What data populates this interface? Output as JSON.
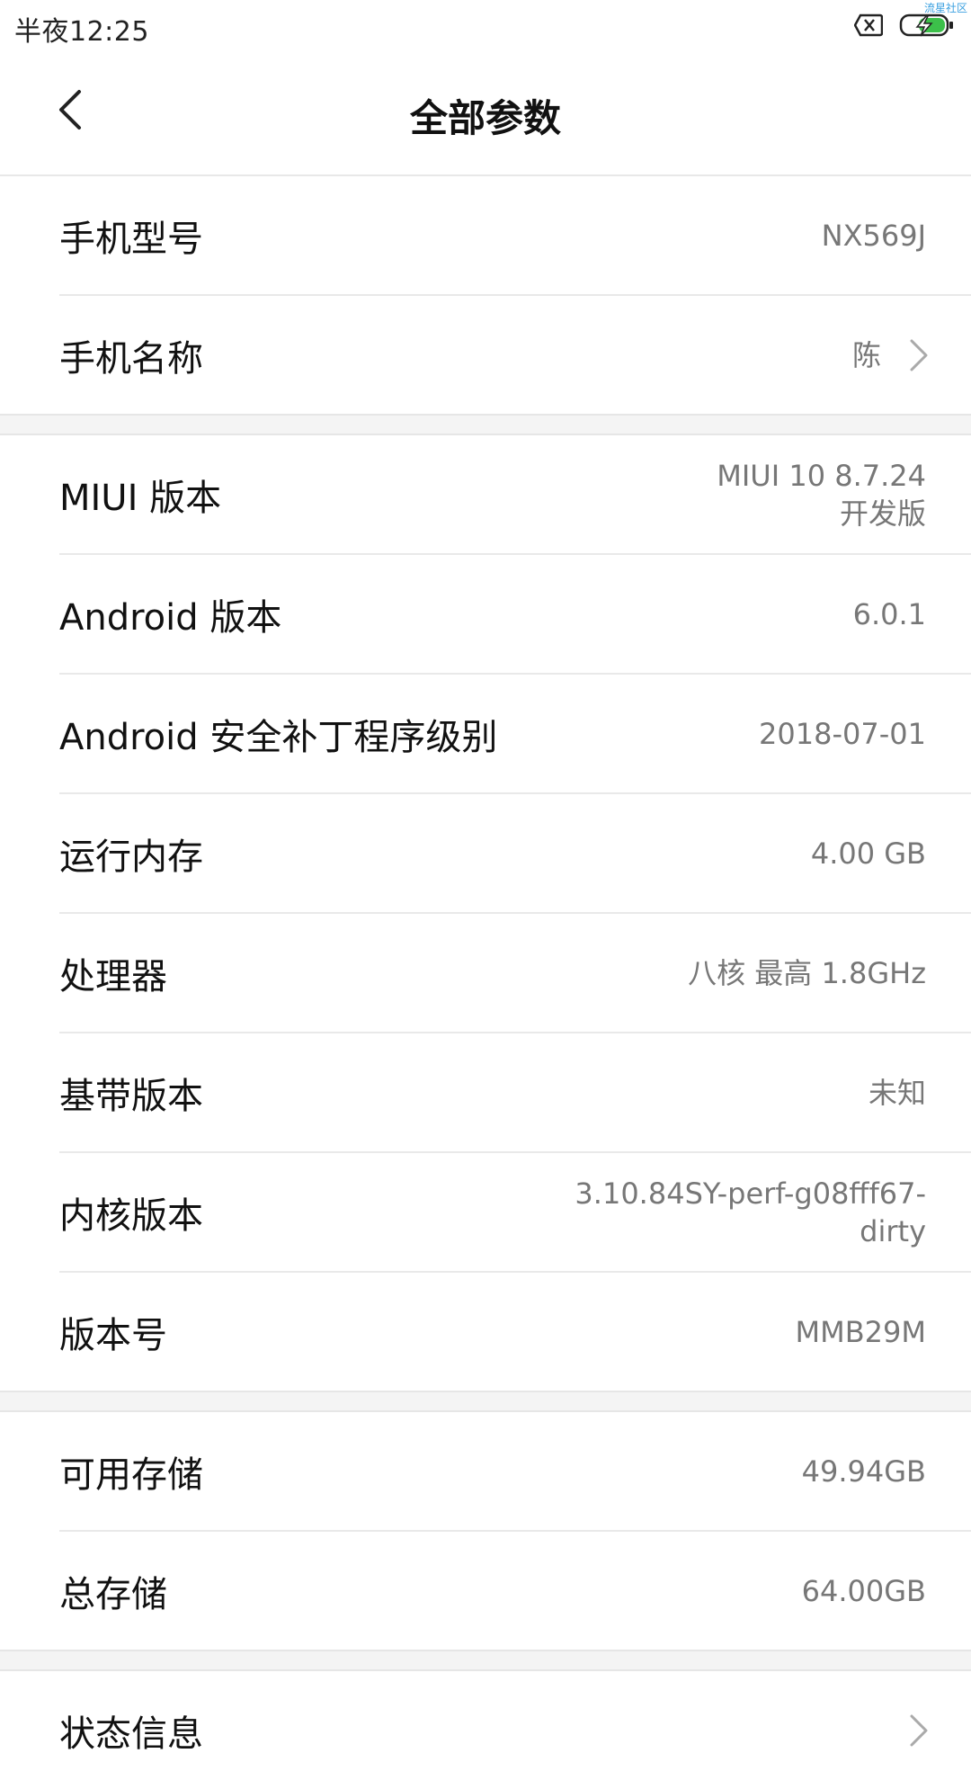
{
  "status_bar": {
    "time": "半夜12:25",
    "watermark": "流星社区",
    "icons": [
      "sim-error-icon",
      "battery-charging-icon"
    ],
    "battery_color": "#3cc04a"
  },
  "header": {
    "title": "全部参数",
    "back_icon": "chevron-left-icon"
  },
  "groups": [
    {
      "rows": [
        {
          "label": "手机型号",
          "value": "NX569J"
        },
        {
          "label": "手机名称",
          "value": "陈",
          "chevron": true
        }
      ]
    },
    {
      "rows": [
        {
          "label": "MIUI 版本",
          "value_line1": "MIUI 10 8.7.24",
          "value_line2": "开发版"
        },
        {
          "label": "Android 版本",
          "value": "6.0.1"
        },
        {
          "label": "Android 安全补丁程序级别",
          "value": "2018-07-01"
        },
        {
          "label": "运行内存",
          "value": "4.00 GB"
        },
        {
          "label": "处理器",
          "value": "八核 最高 1.8GHz"
        },
        {
          "label": "基带版本",
          "value": "未知"
        },
        {
          "label": "内核版本",
          "value_line1": "3.10.84SY-perf-g08fff67-",
          "value_line2": "dirty"
        },
        {
          "label": "版本号",
          "value": "MMB29M"
        }
      ]
    },
    {
      "rows": [
        {
          "label": "可用存储",
          "value": "49.94GB"
        },
        {
          "label": "总存储",
          "value": "64.00GB"
        }
      ]
    },
    {
      "rows": [
        {
          "label": "状态信息",
          "chevron": true
        }
      ]
    }
  ]
}
